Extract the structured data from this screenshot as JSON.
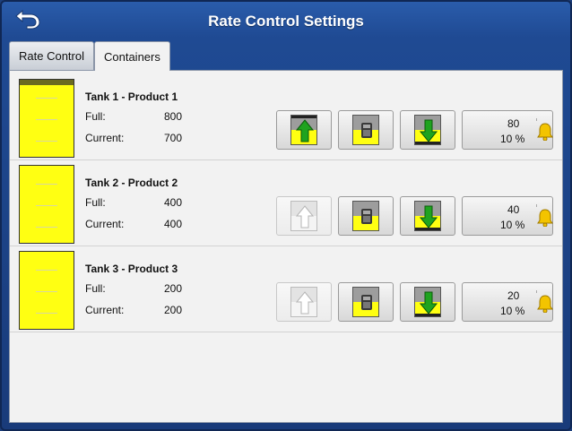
{
  "header": {
    "title": "Rate Control Settings",
    "back_icon": "back-arrow-icon"
  },
  "tabs": [
    {
      "label": "Rate Control",
      "active": false
    },
    {
      "label": "Containers",
      "active": true
    }
  ],
  "labels": {
    "full": "Full:",
    "current": "Current:"
  },
  "tanks": [
    {
      "name": "Tank 1 - Product 1",
      "full": "800",
      "current": "700",
      "alarm_level": "80",
      "alarm_percent": "10 %",
      "fill_enabled": true
    },
    {
      "name": "Tank 2 - Product 2",
      "full": "400",
      "current": "400",
      "alarm_level": "40",
      "alarm_percent": "10 %",
      "fill_enabled": false
    },
    {
      "name": "Tank 3 - Product 3",
      "full": "200",
      "current": "200",
      "alarm_level": "20",
      "alarm_percent": "10 %",
      "fill_enabled": false
    }
  ],
  "colors": {
    "title_bar": "#2a5cab",
    "tank_fill": "#ffff12",
    "arrow_green": "#1fa31f",
    "bell": "#f3c400"
  },
  "icons": {
    "fill_button": "fill-tank-up-arrow-icon",
    "calculator_button": "calculator-icon",
    "empty_button": "empty-tank-down-arrow-icon",
    "alarm": "alarm-bell-icon"
  }
}
